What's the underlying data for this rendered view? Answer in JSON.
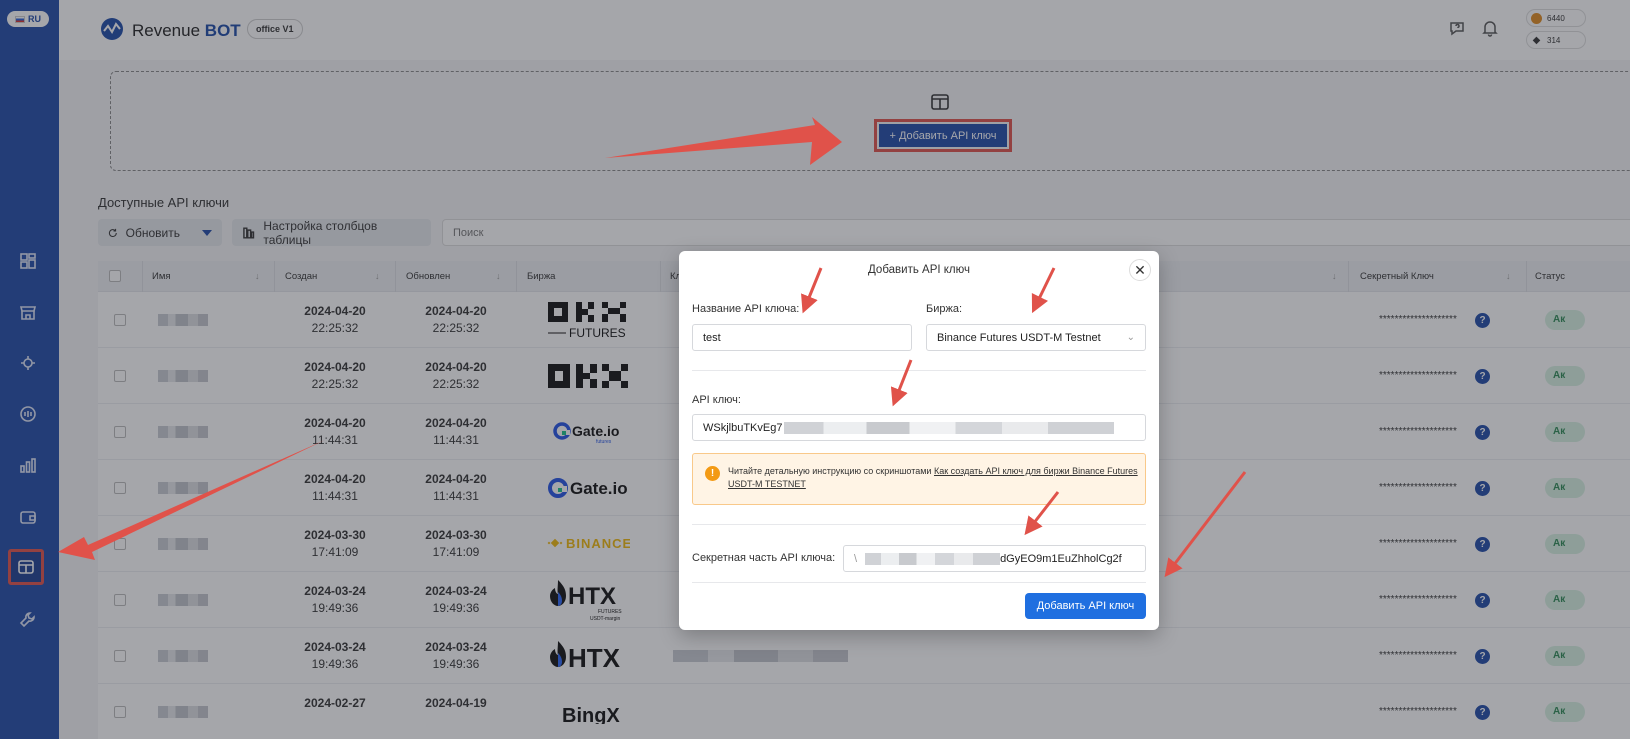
{
  "sidebar": {
    "language": "RU",
    "items": [
      {
        "icon": "dashboard-icon"
      },
      {
        "icon": "store-icon"
      },
      {
        "icon": "bot-icon"
      },
      {
        "icon": "terminal-icon"
      },
      {
        "icon": "stats-icon"
      },
      {
        "icon": "wallet-icon"
      },
      {
        "icon": "api-keys-icon",
        "active": true
      },
      {
        "icon": "tools-icon"
      }
    ]
  },
  "header": {
    "logo_revenue": "Revenue",
    "logo_bot": "BOT",
    "office_tag": "office V1",
    "balance_1": "6440",
    "balance_2": "314"
  },
  "main": {
    "add_button": "+ Добавить API ключ",
    "section_title": "Доступные API ключи",
    "refresh_label": "Обновить",
    "columns_label": "Настройка столбцов таблицы",
    "search_placeholder": "Поиск"
  },
  "table": {
    "headers": {
      "name": "Имя",
      "created": "Создан",
      "updated": "Обновлен",
      "exchange": "Биржа",
      "key": "Кл",
      "secret": "Секретный Ключ",
      "status": "Статус"
    },
    "secret_mask": "********************",
    "status_short": "Ак",
    "rows": [
      {
        "created_date": "2024-04-20",
        "created_time": "22:25:32",
        "updated_date": "2024-04-20",
        "updated_time": "22:25:32",
        "exchange": "OKX FUTURES"
      },
      {
        "created_date": "2024-04-20",
        "created_time": "22:25:32",
        "updated_date": "2024-04-20",
        "updated_time": "22:25:32",
        "exchange": "OKX"
      },
      {
        "created_date": "2024-04-20",
        "created_time": "11:44:31",
        "updated_date": "2024-04-20",
        "updated_time": "11:44:31",
        "exchange": "Gate.io futures"
      },
      {
        "created_date": "2024-04-20",
        "created_time": "11:44:31",
        "updated_date": "2024-04-20",
        "updated_time": "11:44:31",
        "exchange": "Gate.io"
      },
      {
        "created_date": "2024-03-30",
        "created_time": "17:41:09",
        "updated_date": "2024-03-30",
        "updated_time": "17:41:09",
        "exchange": "BINANCE"
      },
      {
        "created_date": "2024-03-24",
        "created_time": "19:49:36",
        "updated_date": "2024-03-24",
        "updated_time": "19:49:36",
        "exchange": "HTX FUTURES USDT-margin"
      },
      {
        "created_date": "2024-03-24",
        "created_time": "19:49:36",
        "updated_date": "2024-03-24",
        "updated_time": "19:49:36",
        "exchange": "HTX"
      },
      {
        "created_date": "2024-02-27",
        "created_time": "",
        "updated_date": "2024-04-19",
        "updated_time": "",
        "exchange": "BingX"
      }
    ]
  },
  "modal": {
    "title": "Добавить API ключ",
    "name_label": "Название API ключа:",
    "name_value": "test",
    "exchange_label": "Биржа:",
    "exchange_value": "Binance Futures USDT-M Testnet",
    "api_key_label": "API ключ:",
    "api_key_value": "WSkjlbuTKvEg7",
    "alert_text": "Читайте детальную инструкцию со скриншотами",
    "alert_link": "Как создать API ключ для биржи Binance Futures USDT-M TESTNET",
    "secret_label": "Секретная часть API ключа:",
    "secret_value_prefix": "\\",
    "secret_value": "dGyEO9m1EuZhholCg2f",
    "submit": "Добавить API ключ"
  },
  "colors": {
    "sidebar": "#1f4aa8",
    "accent": "#1f6fe0",
    "highlight": "#e0524a",
    "status_bg": "#d7f2e2"
  }
}
